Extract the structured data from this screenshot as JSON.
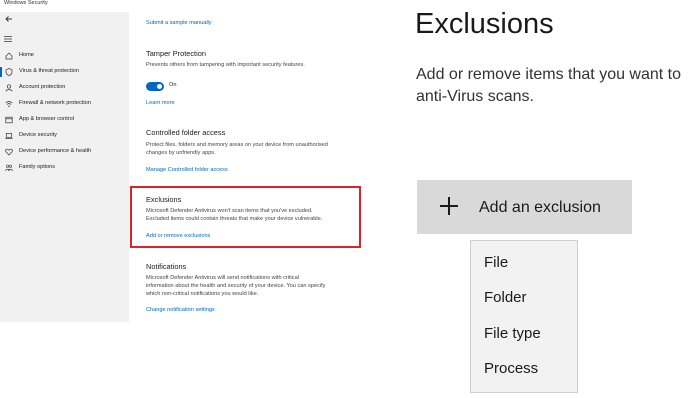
{
  "window": {
    "title": "Windows Security"
  },
  "sidebar": {
    "items": [
      {
        "label": "Home",
        "icon": "home-icon"
      },
      {
        "label": "Virus & threat protection",
        "icon": "shield-icon",
        "active": true
      },
      {
        "label": "Account protection",
        "icon": "person-icon"
      },
      {
        "label": "Firewall & network protection",
        "icon": "wifi-icon"
      },
      {
        "label": "App & browser control",
        "icon": "browser-window-icon"
      },
      {
        "label": "Device security",
        "icon": "laptop-icon"
      },
      {
        "label": "Device performance & health",
        "icon": "heart-icon"
      },
      {
        "label": "Family options",
        "icon": "family-icon"
      }
    ]
  },
  "content": {
    "submit_link": "Submit a sample manually",
    "tamper": {
      "title": "Tamper Protection",
      "desc": "Prevents others from tampering with important security features.",
      "toggle_label": "On",
      "link": "Learn more"
    },
    "cfa": {
      "title": "Controlled folder access",
      "desc_1": "Protect files, folders and memory areas on your device from unauthorised",
      "desc_2": "changes by unfriendly apps.",
      "link": "Manage Controlled folder access"
    },
    "exclusions": {
      "title": "Exclusions",
      "desc_1": "Microsoft Defender Antivirus won't scan items that you've excluded.",
      "desc_2": "Excluded items could contain threats that make your device vulnerable.",
      "link": "Add or remove exclusions"
    },
    "notifications": {
      "title": "Notifications",
      "desc_1": "Microsoft Defender Antivirus will send notifications with critical",
      "desc_2": "information about the health and security of your device. You can specify",
      "desc_3": "which non-critical notifications you would like.",
      "link": "Change notification settings"
    }
  },
  "zoom": {
    "title": "Exclusions",
    "desc_1": "Add or remove items that you want to",
    "desc_2": "anti-Virus scans.",
    "add_button": "Add an exclusion",
    "options": [
      "File",
      "Folder",
      "File type",
      "Process"
    ]
  },
  "colors": {
    "accent": "#0067c0",
    "highlight": "#d7262b",
    "sidebar_bg": "#f1f1f1"
  }
}
